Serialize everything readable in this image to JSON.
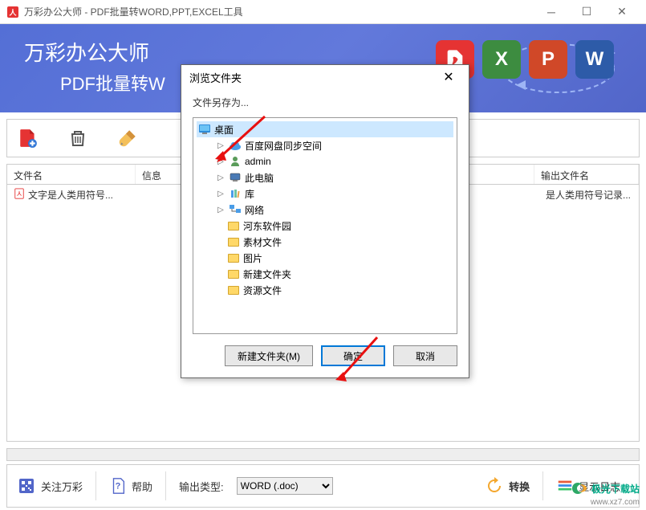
{
  "window": {
    "title": "万彩办公大师 - PDF批量转WORD,PPT,EXCEL工具"
  },
  "banner": {
    "title": "万彩办公大师",
    "subtitle": "PDF批量转W",
    "badges": {
      "x": "X",
      "p": "P",
      "w": "W"
    }
  },
  "list": {
    "headers": {
      "name": "文件名",
      "info": "信息",
      "output": "输出文件名"
    },
    "row": {
      "name": "文字是人类用符号...",
      "tail": "是人类用符号记录..."
    }
  },
  "bottom": {
    "about": "关注万彩",
    "help": "帮助",
    "output_type_label": "输出类型:",
    "output_type_value": "WORD (.doc)",
    "convert": "转换",
    "log": "显示日志..."
  },
  "dialog": {
    "title": "浏览文件夹",
    "save_as": "文件另存为...",
    "tree": {
      "desktop": "桌面",
      "baidu": "百度网盘同步空间",
      "admin": "admin",
      "thispc": "此电脑",
      "library": "库",
      "network": "网络",
      "hedong": "河东软件园",
      "sucai": "素材文件",
      "tupian": "图片",
      "xinjian": "新建文件夹",
      "ziyuan": "资源文件"
    },
    "buttons": {
      "new_folder": "新建文件夹(M)",
      "ok": "确定",
      "cancel": "取消"
    }
  },
  "watermark": {
    "name": "极光下载站",
    "url": "www.xz7.com"
  }
}
